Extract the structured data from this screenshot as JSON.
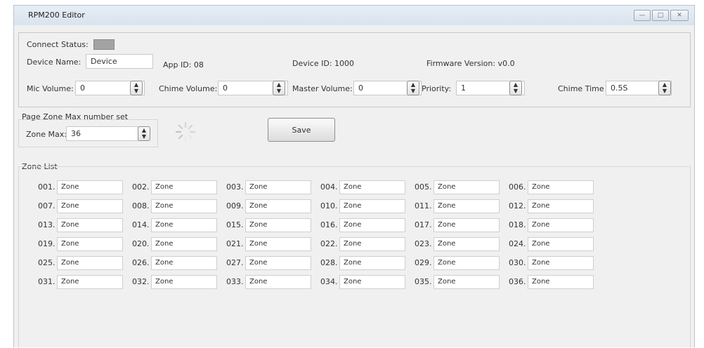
{
  "window": {
    "title": "RPM200 Editor",
    "minimize_label": "—",
    "maximize_label": "□",
    "close_label": "✕"
  },
  "device": {
    "connect_status_label": "Connect Status:",
    "connect_status_color": "#a3a3a3",
    "device_name_label": "Device Name:",
    "device_name_value": "Device",
    "app_id": "App ID: 08",
    "device_id": "Device ID: 1000",
    "firmware_version": "Firmware Version: v0.0",
    "mic_volume_label": "Mic Volume:",
    "mic_volume_value": "0",
    "chime_volume_label": "Chime Volume:",
    "chime_volume_value": "0",
    "master_volume_label": "Master Volume:",
    "master_volume_value": "0",
    "priority_label": "Priority:",
    "priority_value": "1",
    "chime_time_label": "Chime Time",
    "chime_time_value": "0.5S"
  },
  "zone_max": {
    "group_title": "Page Zone Max number set",
    "label": "Zone Max:",
    "value": "36"
  },
  "save_label": "Save",
  "zone_list": {
    "title": "Zone List",
    "zones": [
      {
        "num": "001.",
        "name": "Zone"
      },
      {
        "num": "002.",
        "name": "Zone"
      },
      {
        "num": "003.",
        "name": "Zone"
      },
      {
        "num": "004.",
        "name": "Zone"
      },
      {
        "num": "005.",
        "name": "Zone"
      },
      {
        "num": "006.",
        "name": "Zone"
      },
      {
        "num": "007.",
        "name": "Zone"
      },
      {
        "num": "008.",
        "name": "Zone"
      },
      {
        "num": "009.",
        "name": "Zone"
      },
      {
        "num": "010.",
        "name": "Zone"
      },
      {
        "num": "011.",
        "name": "Zone"
      },
      {
        "num": "012.",
        "name": "Zone"
      },
      {
        "num": "013.",
        "name": "Zone"
      },
      {
        "num": "014.",
        "name": "Zone"
      },
      {
        "num": "015.",
        "name": "Zone"
      },
      {
        "num": "016.",
        "name": "Zone"
      },
      {
        "num": "017.",
        "name": "Zone"
      },
      {
        "num": "018.",
        "name": "Zone"
      },
      {
        "num": "019.",
        "name": "Zone"
      },
      {
        "num": "020.",
        "name": "Zone"
      },
      {
        "num": "021.",
        "name": "Zone"
      },
      {
        "num": "022.",
        "name": "Zone"
      },
      {
        "num": "023.",
        "name": "Zone"
      },
      {
        "num": "024.",
        "name": "Zone"
      },
      {
        "num": "025.",
        "name": "Zone"
      },
      {
        "num": "026.",
        "name": "Zone"
      },
      {
        "num": "027.",
        "name": "Zone"
      },
      {
        "num": "028.",
        "name": "Zone"
      },
      {
        "num": "029.",
        "name": "Zone"
      },
      {
        "num": "030.",
        "name": "Zone"
      },
      {
        "num": "031.",
        "name": "Zone"
      },
      {
        "num": "032.",
        "name": "Zone"
      },
      {
        "num": "033.",
        "name": "Zone"
      },
      {
        "num": "034.",
        "name": "Zone"
      },
      {
        "num": "035.",
        "name": "Zone"
      },
      {
        "num": "036.",
        "name": "Zone"
      }
    ]
  },
  "icons": {
    "spinner_up": "▲",
    "spinner_down": "▼",
    "loading": "loading-spinner-icon"
  }
}
